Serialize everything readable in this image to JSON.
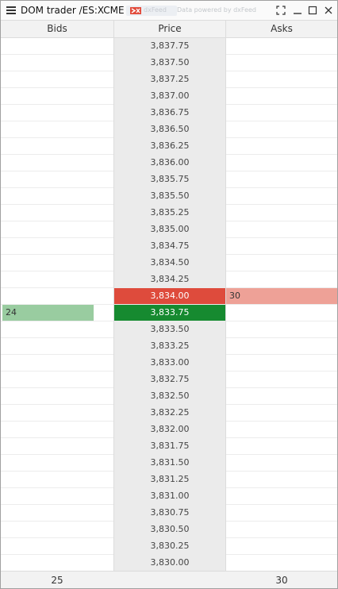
{
  "window": {
    "title": "DOM trader /ES:XCME",
    "feed_badge_text": "dxFeed",
    "powered_text": "Data powered by dxFeed",
    "icons": [
      "menu-icon",
      "expand-icon",
      "minimize-icon",
      "maximize-icon",
      "close-icon"
    ]
  },
  "columns": {
    "bids": "Bids",
    "price": "Price",
    "asks": "Asks"
  },
  "colors": {
    "best_ask": "#de4b3c",
    "best_bid": "#168a30",
    "bid_bar": "#99cca0",
    "ask_bar": "#eea197",
    "price_column": "#ebebeb"
  },
  "ladder": [
    {
      "price": "3,837.75",
      "bid": "",
      "ask": ""
    },
    {
      "price": "3,837.50",
      "bid": "",
      "ask": ""
    },
    {
      "price": "3,837.25",
      "bid": "",
      "ask": ""
    },
    {
      "price": "3,837.00",
      "bid": "",
      "ask": ""
    },
    {
      "price": "3,836.75",
      "bid": "",
      "ask": ""
    },
    {
      "price": "3,836.50",
      "bid": "",
      "ask": ""
    },
    {
      "price": "3,836.25",
      "bid": "",
      "ask": ""
    },
    {
      "price": "3,836.00",
      "bid": "",
      "ask": ""
    },
    {
      "price": "3,835.75",
      "bid": "",
      "ask": ""
    },
    {
      "price": "3,835.50",
      "bid": "",
      "ask": ""
    },
    {
      "price": "3,835.25",
      "bid": "",
      "ask": ""
    },
    {
      "price": "3,835.00",
      "bid": "",
      "ask": ""
    },
    {
      "price": "3,834.75",
      "bid": "",
      "ask": ""
    },
    {
      "price": "3,834.50",
      "bid": "",
      "ask": ""
    },
    {
      "price": "3,834.25",
      "bid": "",
      "ask": ""
    },
    {
      "price": "3,834.00",
      "bid": "",
      "ask": "30",
      "ask_fill": 1.0,
      "state": "best-ask"
    },
    {
      "price": "3,833.75",
      "bid": "24",
      "ask": "",
      "bid_fill": 0.82,
      "state": "best-bid"
    },
    {
      "price": "3,833.50",
      "bid": "",
      "ask": ""
    },
    {
      "price": "3,833.25",
      "bid": "",
      "ask": ""
    },
    {
      "price": "3,833.00",
      "bid": "",
      "ask": ""
    },
    {
      "price": "3,832.75",
      "bid": "",
      "ask": ""
    },
    {
      "price": "3,832.50",
      "bid": "",
      "ask": ""
    },
    {
      "price": "3,832.25",
      "bid": "",
      "ask": ""
    },
    {
      "price": "3,832.00",
      "bid": "",
      "ask": ""
    },
    {
      "price": "3,831.75",
      "bid": "",
      "ask": ""
    },
    {
      "price": "3,831.50",
      "bid": "",
      "ask": ""
    },
    {
      "price": "3,831.25",
      "bid": "",
      "ask": ""
    },
    {
      "price": "3,831.00",
      "bid": "",
      "ask": ""
    },
    {
      "price": "3,830.75",
      "bid": "",
      "ask": ""
    },
    {
      "price": "3,830.50",
      "bid": "",
      "ask": ""
    },
    {
      "price": "3,830.25",
      "bid": "",
      "ask": ""
    },
    {
      "price": "3,830.00",
      "bid": "",
      "ask": ""
    }
  ],
  "footer": {
    "bids_total": "25",
    "asks_total": "30"
  }
}
